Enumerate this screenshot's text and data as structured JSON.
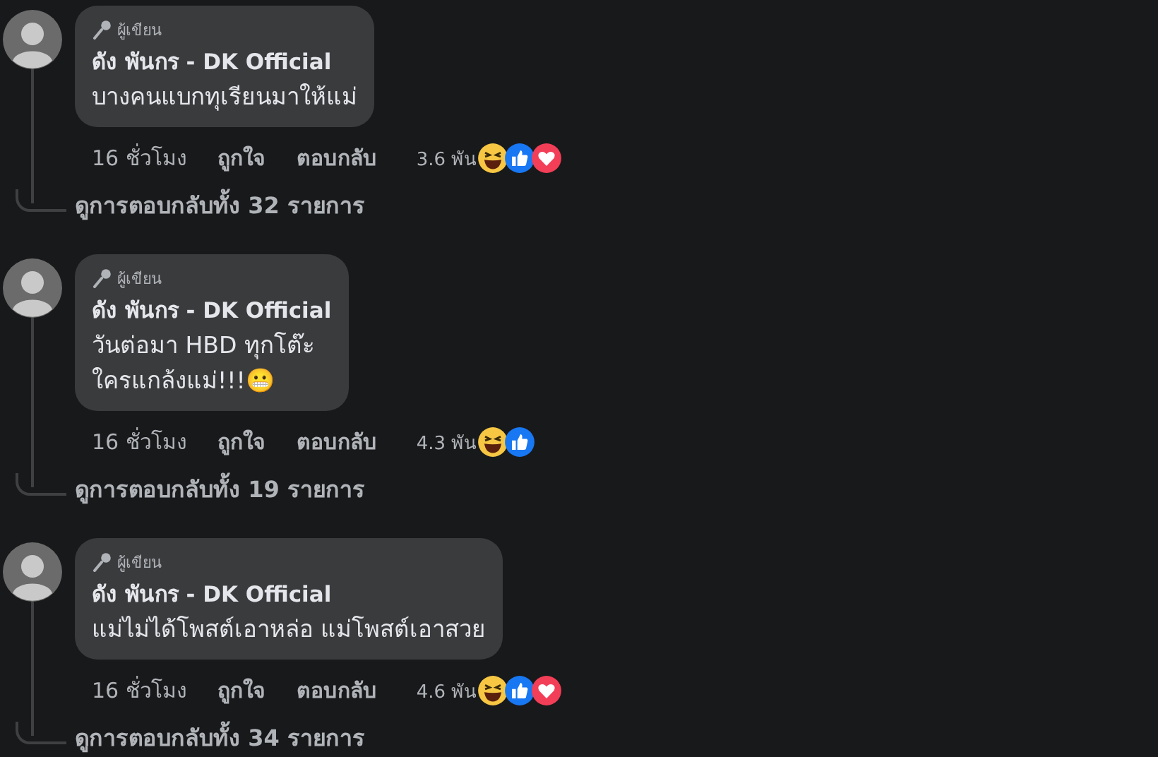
{
  "comments": [
    {
      "badge": "ผู้เขียน",
      "author": "ดัง พันกร - DK Official",
      "lines": [
        "บางคนแบกทุเรียนมาให้แม่"
      ],
      "time": "16 ชั่วโมง",
      "like": "ถูกใจ",
      "reply": "ตอบกลับ",
      "reaction_count": "3.6 พัน",
      "reactions": [
        {
          "kind": "haha"
        },
        {
          "kind": "like"
        },
        {
          "kind": "love"
        }
      ],
      "view_replies": "ดูการตอบกลับทั้ง 32 รายการ"
    },
    {
      "badge": "ผู้เขียน",
      "author": "ดัง พันกร - DK Official",
      "lines": [
        "วันต่อมา HBD ทุกโต๊ะ",
        "ใครแกล้งแม่!!!😬"
      ],
      "time": "16 ชั่วโมง",
      "like": "ถูกใจ",
      "reply": "ตอบกลับ",
      "reaction_count": "4.3 พัน",
      "reactions": [
        {
          "kind": "haha"
        },
        {
          "kind": "like"
        }
      ],
      "view_replies": "ดูการตอบกลับทั้ง 19 รายการ"
    },
    {
      "badge": "ผู้เขียน",
      "author": "ดัง พันกร - DK Official",
      "lines": [
        "แม่ไม่ได้โพสต์เอาหล่อ แม่โพสต์เอาสวย"
      ],
      "time": "16 ชั่วโมง",
      "like": "ถูกใจ",
      "reply": "ตอบกลับ",
      "reaction_count": "4.6 พัน",
      "reactions": [
        {
          "kind": "haha"
        },
        {
          "kind": "like"
        },
        {
          "kind": "love"
        }
      ],
      "view_replies": "ดูการตอบกลับทั้ง 34 รายการ"
    }
  ]
}
